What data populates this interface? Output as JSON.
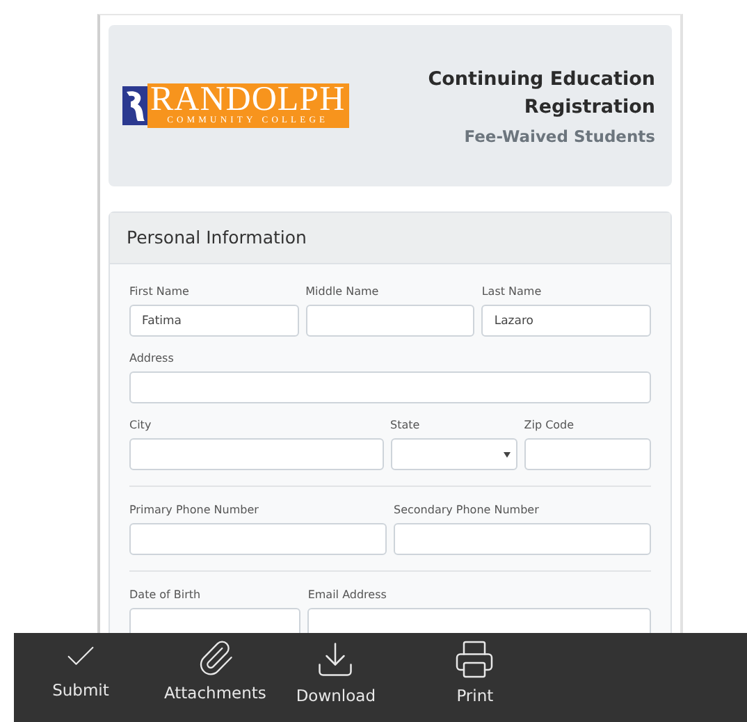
{
  "header": {
    "logo": {
      "name": "RANDOLPH",
      "tagline": "COMMUNITY COLLEGE"
    },
    "title": "Continuing Education Registration",
    "subtitle": "Fee-Waived Students"
  },
  "section": {
    "title": "Personal Information",
    "rows": [
      {
        "divided": false,
        "fields": [
          {
            "kind": "text",
            "label": "First Name",
            "value": "Fatima"
          },
          {
            "kind": "text",
            "label": "Middle Name"
          },
          {
            "kind": "text",
            "label": "Last Name",
            "value": "Lazaro"
          }
        ]
      },
      {
        "divided": false,
        "fields": [
          {
            "kind": "text",
            "label": "Address"
          }
        ]
      },
      {
        "divided": false,
        "fields": [
          {
            "kind": "text",
            "label": "City"
          },
          {
            "kind": "select",
            "label": "State"
          },
          {
            "kind": "text",
            "label": "Zip Code"
          }
        ]
      },
      {
        "divided": true,
        "fields": [
          {
            "kind": "text",
            "label": "Primary Phone Number"
          },
          {
            "kind": "text",
            "label": "Secondary Phone Number"
          }
        ]
      },
      {
        "divided": true,
        "fields": [
          {
            "kind": "text",
            "label": "Date of Birth"
          },
          {
            "kind": "text",
            "label": "Email Address"
          }
        ]
      }
    ]
  },
  "toolbar": [
    {
      "kind": "submit",
      "label": "Submit"
    },
    {
      "kind": "attach",
      "label": "Attachments"
    },
    {
      "kind": "download",
      "label": "Download"
    },
    {
      "kind": "print",
      "label": "Print"
    }
  ]
}
